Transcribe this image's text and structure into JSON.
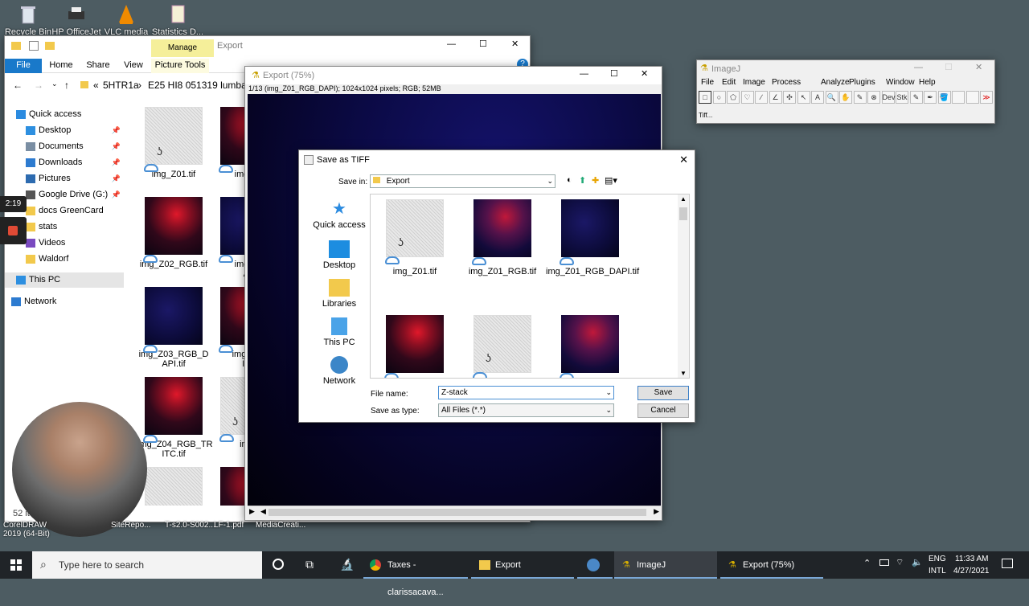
{
  "desktop": {
    "icons": [
      {
        "label": "Recycle Bin",
        "icon": "recycle-bin-icon"
      },
      {
        "label": "HP OfficeJet",
        "icon": "printer-icon"
      },
      {
        "label": "VLC media",
        "icon": "vlc-icon"
      },
      {
        "label": "Statistics D...",
        "icon": "document-icon"
      }
    ],
    "bottom_labels": [
      "CorelDRAW",
      "2019 (64-Bit)",
      "SiteRepo...",
      "T-s2.0-S002...",
      "LF-1.pdf",
      "MediaCreati..."
    ]
  },
  "overlay": {
    "timer": "2:19"
  },
  "explorer": {
    "title": "Export",
    "manage_tab": "Manage",
    "ribbon_tabs": [
      "File",
      "Home",
      "Share",
      "View",
      "Picture Tools"
    ],
    "breadcrumb": [
      "«",
      "5HTR1a",
      "›",
      "E25 HI8 051319 lumbar slice"
    ],
    "nav": [
      {
        "label": "Quick access",
        "pinned": false
      },
      {
        "label": "Desktop",
        "pinned": true
      },
      {
        "label": "Documents",
        "pinned": true
      },
      {
        "label": "Downloads",
        "pinned": true
      },
      {
        "label": "Pictures",
        "pinned": true
      },
      {
        "label": "Google Drive (G:)",
        "pinned": true
      },
      {
        "label": "docs GreenCard",
        "pinned": false
      },
      {
        "label": "stats",
        "pinned": false
      },
      {
        "label": "Videos",
        "pinned": false
      },
      {
        "label": "Waldorf",
        "pinned": false
      },
      {
        "label": "This PC",
        "pinned": false
      },
      {
        "label": "Network",
        "pinned": false
      }
    ],
    "files": [
      {
        "name": "img_Z01.tif",
        "kind": "gray"
      },
      {
        "name": "img_Z0",
        "kind": "red"
      },
      {
        "name": "img_Z02_RGB.tif",
        "kind": "red"
      },
      {
        "name": "img_Z0\nAP",
        "kind": "blue"
      },
      {
        "name": "img_Z03_RGB_D\nAPI.tif",
        "kind": "blue"
      },
      {
        "name": "img_Z03\nITC",
        "kind": "red"
      },
      {
        "name": "img_Z04_RGB_TR\nITC.tif",
        "kind": "red"
      },
      {
        "name": "img_",
        "kind": "gray"
      },
      {
        "name": "",
        "kind": "gray"
      },
      {
        "name": "",
        "kind": "red"
      }
    ],
    "status": "52 ite"
  },
  "export_window": {
    "title": "Export (75%)",
    "info": "1/13 (img_Z01_RGB_DAPI); 1024x1024 pixels; RGB; 52MB"
  },
  "save_dialog": {
    "title": "Save as TIFF",
    "save_in_label": "Save in:",
    "save_in_value": "Export",
    "places": [
      "Quick access",
      "Desktop",
      "Libraries",
      "This PC",
      "Network"
    ],
    "files": [
      {
        "name": "img_Z01.tif",
        "kind": "gray"
      },
      {
        "name": "img_Z01_RGB.tif",
        "kind": "purple"
      },
      {
        "name": "img_Z01_RGB_DAPI.tif",
        "kind": "blue"
      },
      {
        "name": "",
        "kind": "red"
      },
      {
        "name": "",
        "kind": "gray"
      },
      {
        "name": "",
        "kind": "purple"
      }
    ],
    "file_name_label": "File name:",
    "file_name_value": "Z-stack",
    "save_as_type_label": "Save as type:",
    "save_as_type_value": "All Files (*.*)",
    "save_button": "Save",
    "cancel_button": "Cancel"
  },
  "imagej": {
    "title": "ImageJ",
    "menu": [
      "File",
      "Edit",
      "Image",
      "Process",
      "Analyze",
      "Plugins",
      "Window",
      "Help"
    ],
    "tools": [
      "□",
      "○",
      "⬠",
      "♡",
      "∕",
      "∠",
      "✣",
      "↖",
      "A",
      "🔍",
      "✋",
      "✎",
      "⊗",
      "Dev",
      "Stk",
      "✎",
      "✒",
      "🪣",
      "",
      "",
      "≫"
    ],
    "status": "Tiff..."
  },
  "taskbar": {
    "search_placeholder": "Type here to search",
    "items": [
      "Taxes - clarissacava...",
      "Export",
      "",
      "ImageJ",
      "Export (75%)"
    ],
    "lang_top": "ENG",
    "lang_bottom": "INTL",
    "time": "11:33 AM",
    "date": "4/27/2021"
  }
}
